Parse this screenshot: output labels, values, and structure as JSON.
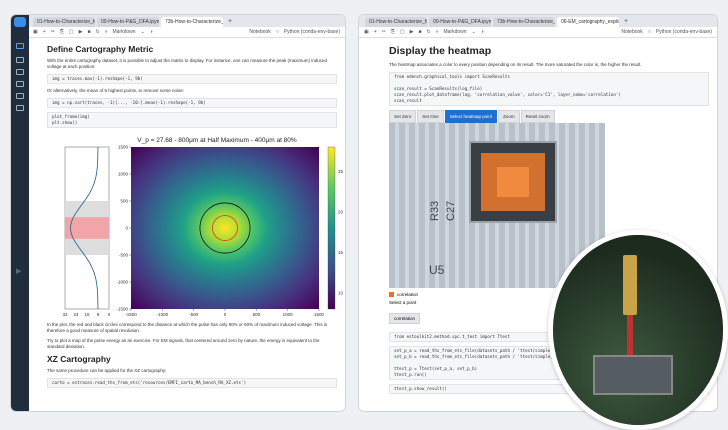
{
  "left": {
    "tabs": [
      "01-How-to-Characterize_fau",
      "00-How-to-P&G_DFA.ipynb",
      "73b-How-to-Characterize_D"
    ],
    "toolbar": {
      "mode": "Markdown",
      "notebook": "Notebook",
      "kernel": "Python (conda-env-base)"
    },
    "heading1": "Define Cartography Metric",
    "para1": "With the entire cartography dataset, it is possible to adjust the matrix to display. For instance, one can measure the peak (maximum) induced voltage at each position:",
    "cell1": "img = traces.max(-1).reshape(-1, 9b)",
    "para2": "Or alternatively, the mean of 5 highest points, to remove some noise:",
    "cell2": "img = np.sort(traces, -1)[..., -10:].mean(-1).reshape(-1, 9b)",
    "cell3": "plot_frame(img)\nplt.show()",
    "chart_title": "V_p = 27.68  -  800μm at Half Maximum  -  400μm at 80%",
    "para3": "In the plot, the red and black circles correspond to the distance at which the pulse has only 80% or 60% of maximum induced voltage. This is therefore a good measure of spatial resolution.",
    "para4": "Try to plot a map of the pulse energy as an exercise. For EM signals, that centered around zero by nature, the energy is equivalent to the standard deviation.",
    "heading2": "XZ Cartography",
    "para5": "The same procedure can be applied for the XZ cartography:",
    "cell4": "carto = estraces.read_ths_from_ets('resources/EMFI_carto_MA_bench_RA_XZ.ets')"
  },
  "right": {
    "tabs": [
      "01-How-to-Characterize_fau",
      "00-How-to-P&G_DFA.ipynb",
      "73b-How-to-Characterize_D",
      "06-EM_cartography_exploita"
    ],
    "toolbar": {
      "mode": "Markdown",
      "notebook": "Notebook",
      "kernel": "Python (conda-env-base)"
    },
    "heading": "Display the heatmap",
    "para": "The heatmap associates a color to every position depending on its result. The more saturated the color is, the higher the result.",
    "cell1": "from edench.graphical_tools import ScanResults\n\nscan_result = ScanResults(log_file)\nscan_result.plot_dataframe(log, 'correlation_value', color='C1', layer_name='correlation')\nscan_result",
    "buttons": [
      "Set Zero",
      "Set One",
      "Select heatmap point",
      "Zoom",
      "Reset zoom"
    ],
    "legend_label": "correlation",
    "select_label": "Select a point",
    "select_value": "correlation",
    "cell2": "from estoolkit2.method.spc.t_test import Ttest",
    "cell3": "set_p_a = read_ths_from_ets_file(datasets_path / 'ttest/simple_\nset_p_b = read_ths_from_ets_file(datasets_path / 'ttest/simple_\n\nttest_p = Ttest(set_p_a, set_p_b)\nttest_p.run()",
    "cell4": "ttest_p.show_result()",
    "chip_labels": [
      "R33",
      "C27",
      "U5"
    ]
  },
  "chart_data": {
    "type": "heatmap",
    "title": "V_p = 27.68  -  800μm at Half Maximum  -  400μm at 80%",
    "xlim": [
      -1500,
      1500
    ],
    "ylim": [
      -1500,
      1500
    ],
    "xticks": [
      -1500,
      -1000,
      -500,
      0,
      500,
      1000,
      1500
    ],
    "yticks": [
      -1500,
      -1000,
      -500,
      0,
      500,
      1000,
      1500
    ],
    "colorbar_ticks": [
      10,
      15,
      20,
      25
    ],
    "side_profile_ticks": [
      "32",
      "24",
      "16",
      "8",
      "0"
    ],
    "peak_value": 27.68
  }
}
